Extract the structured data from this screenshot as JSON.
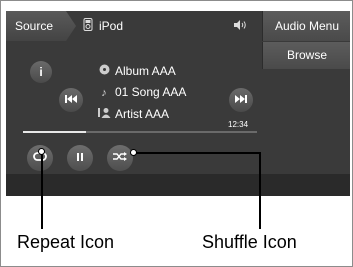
{
  "header": {
    "source_label": "Source",
    "source_icon": "ipod-icon",
    "source_name": "iPod",
    "volume_icon": "speaker-volume-icon",
    "audio_menu_label": "Audio Menu",
    "browse_label": "Browse"
  },
  "track": {
    "album_icon": "album-icon",
    "album": "Album AAA",
    "song_icon": "music-note-icon",
    "song": "01 Song AAA",
    "artist_icon": "artist-icon",
    "artist": "Artist AAA",
    "time": "12:34",
    "progress": 0.27
  },
  "controls": {
    "info_icon": "info-icon",
    "info_label": "i",
    "prev_icon": "skip-previous-icon",
    "next_icon": "skip-next-icon",
    "repeat_icon": "repeat-icon",
    "pause_icon": "pause-icon",
    "shuffle_icon": "shuffle-icon"
  },
  "callouts": {
    "repeat": "Repeat Icon",
    "shuffle": "Shuffle Icon"
  },
  "colors": {
    "screen_bg": "#3a3a3a",
    "button_bg": "#555555",
    "text": "#ffffff"
  }
}
